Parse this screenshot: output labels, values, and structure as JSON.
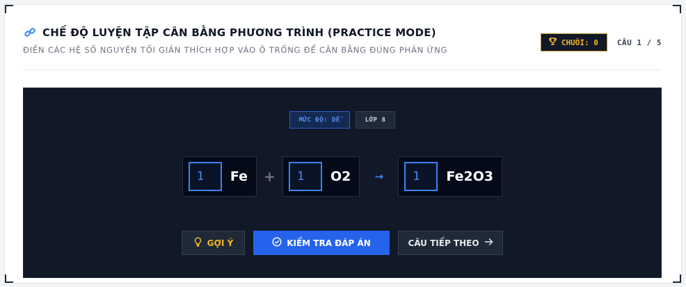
{
  "header": {
    "title": "CHẾ ĐỘ LUYỆN TẬP CÂN BẰNG PHƯƠNG TRÌNH (PRACTICE MODE)",
    "subtitle": "ĐIỀN CÁC HỆ SỐ NGUYÊN TỐI GIẢN THÍCH HỢP VÀO Ô TRỐNG ĐỂ CÂN BẰNG ĐÚNG PHẢN ỨNG",
    "title_icon": "flask-link-icon",
    "streak_label": "CHUỖI: 0",
    "streak_icon": "trophy-icon",
    "question_counter": "CÂU 1 / 5"
  },
  "tags": {
    "level": "MỨC ĐỘ: DỄ",
    "grade": "LỚP 8"
  },
  "equation": {
    "terms": [
      {
        "coefficient": "1",
        "formula": "Fe"
      },
      {
        "coefficient": "1",
        "formula": "O2"
      },
      {
        "coefficient": "1",
        "formula": "Fe2O3"
      }
    ],
    "plus": "+",
    "arrow": "→"
  },
  "actions": {
    "hint_label": "GỢI Ý",
    "hint_icon": "lightbulb-icon",
    "check_label": "KIỂM TRA ĐÁP ÁN",
    "check_icon": "check-circle-icon",
    "next_label": "CÂU TIẾP THEO",
    "next_icon": "arrow-right-icon"
  },
  "colors": {
    "panel_bg": "#111827",
    "accent_blue": "#2563eb",
    "accent_gold": "#f5b528",
    "text_dark": "#111827"
  }
}
